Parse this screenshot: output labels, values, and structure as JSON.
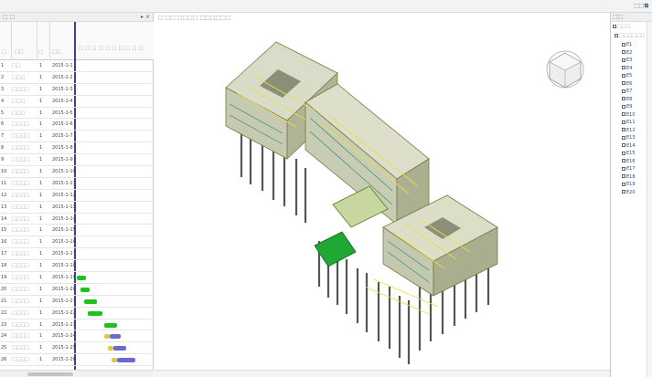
{
  "window": {
    "top_button": "⬚⬚⧉"
  },
  "left_panel": {
    "header_left": "⬚ ⬚",
    "header_right": "▸ ×",
    "col_id": "⬚",
    "col_name": "⬚⬚",
    "col_dur": "⬚",
    "col_date": "⬚⬚",
    "gantt_header": "⬚ ⬚ ⬚ ⬚ ⬚ ⬚ ⬚ ⬚ ⬚ ⬚",
    "rows": [
      {
        "id": "1",
        "name": "⬚⬚",
        "dur": "1",
        "date": "2015-1-1"
      },
      {
        "id": "2",
        "name": "⬚⬚⬚",
        "dur": "1",
        "date": "2015-1-2"
      },
      {
        "id": "3",
        "name": "⬚⬚⬚⬚",
        "dur": "1",
        "date": "2015-1-3"
      },
      {
        "id": "4",
        "name": "⬚⬚⬚",
        "dur": "1",
        "date": "2015-1-4"
      },
      {
        "id": "5",
        "name": "⬚⬚⬚",
        "dur": "1",
        "date": "2015-1-5"
      },
      {
        "id": "6",
        "name": "⬚⬚⬚⬚",
        "dur": "1",
        "date": "2015-1-6"
      },
      {
        "id": "7",
        "name": "⬚⬚⬚⬚",
        "dur": "1",
        "date": "2015-1-7"
      },
      {
        "id": "8",
        "name": "⬚⬚⬚⬚",
        "dur": "1",
        "date": "2015-1-8"
      },
      {
        "id": "9",
        "name": "⬚⬚⬚⬚",
        "dur": "1",
        "date": "2015-1-9"
      },
      {
        "id": "10",
        "name": "⬚⬚⬚⬚",
        "dur": "1",
        "date": "2015-1-10"
      },
      {
        "id": "11",
        "name": "⬚⬚⬚⬚",
        "dur": "1",
        "date": "2015-1-11"
      },
      {
        "id": "12",
        "name": "⬚⬚⬚⬚",
        "dur": "1",
        "date": "2015-1-12"
      },
      {
        "id": "13",
        "name": "⬚⬚⬚⬚",
        "dur": "1",
        "date": "2015-1-13"
      },
      {
        "id": "14",
        "name": "⬚⬚⬚⬚",
        "dur": "1",
        "date": "2015-1-14"
      },
      {
        "id": "15",
        "name": "⬚⬚⬚⬚",
        "dur": "1",
        "date": "2015-1-15"
      },
      {
        "id": "16",
        "name": "⬚⬚⬚⬚",
        "dur": "1",
        "date": "2015-1-16"
      },
      {
        "id": "17",
        "name": "⬚⬚⬚⬚",
        "dur": "1",
        "date": "2015-1-17"
      },
      {
        "id": "18",
        "name": "⬚⬚⬚⬚",
        "dur": "1",
        "date": "2015-1-18"
      },
      {
        "id": "19",
        "name": "⬚⬚⬚⬚",
        "dur": "1",
        "date": "2015-1-19"
      },
      {
        "id": "20",
        "name": "⬚⬚⬚⬚",
        "dur": "1",
        "date": "2015-1-20"
      },
      {
        "id": "21",
        "name": "⬚⬚⬚⬚",
        "dur": "1",
        "date": "2015-1-21"
      },
      {
        "id": "22",
        "name": "⬚⬚⬚⬚",
        "dur": "1",
        "date": "2015-1-22"
      },
      {
        "id": "23",
        "name": "⬚⬚⬚⬚",
        "dur": "1",
        "date": "2015-1-23"
      },
      {
        "id": "24",
        "name": "⬚⬚⬚⬚",
        "dur": "1",
        "date": "2015-1-24"
      },
      {
        "id": "25",
        "name": "⬚⬚⬚⬚",
        "dur": "1",
        "date": "2015-1-25"
      },
      {
        "id": "26",
        "name": "⬚⬚⬚⬚",
        "dur": "1",
        "date": "2015-1-26"
      }
    ]
  },
  "viewport": {
    "title": "⬚ ⬚⬚ ⬚⬚⬚⬚ ⬚⬚⬚⬚⬚⬚"
  },
  "right_panel": {
    "header": "⬚⬚",
    "root": "⬚⬚⬚",
    "child": "⬚⬚⬚⬚⬚⬚",
    "items": [
      "E1",
      "E2",
      "E3",
      "E4",
      "E5",
      "E6",
      "E7",
      "E8",
      "E9",
      "E10",
      "E11",
      "E12",
      "E13",
      "E14",
      "E15",
      "E16",
      "E17",
      "E18",
      "E19",
      "E20"
    ]
  },
  "colors": {
    "green_bar": "#1ec21e",
    "blue_bar": "#6a6ad0",
    "yellow_bar": "#e7c545",
    "divider": "#3b3fa8",
    "steel": "#e8e86a"
  }
}
